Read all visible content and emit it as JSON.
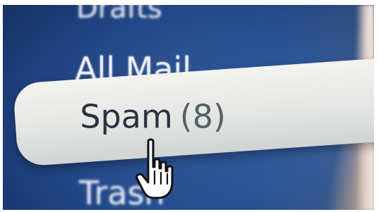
{
  "mail_sidebar": {
    "folders": [
      {
        "label": "Drafts"
      },
      {
        "label": "All Mail"
      },
      {
        "label": "Spam",
        "count": "(8)",
        "state": "selected"
      },
      {
        "label": "Trash"
      }
    ]
  },
  "pointer": {
    "icon": "hand-pointer-icon"
  },
  "colors": {
    "sidebar_background": "#234a8c",
    "folder_text": "#f2f4fa",
    "selected_row": "#e4e6e4",
    "selected_text": "#2b3340"
  }
}
